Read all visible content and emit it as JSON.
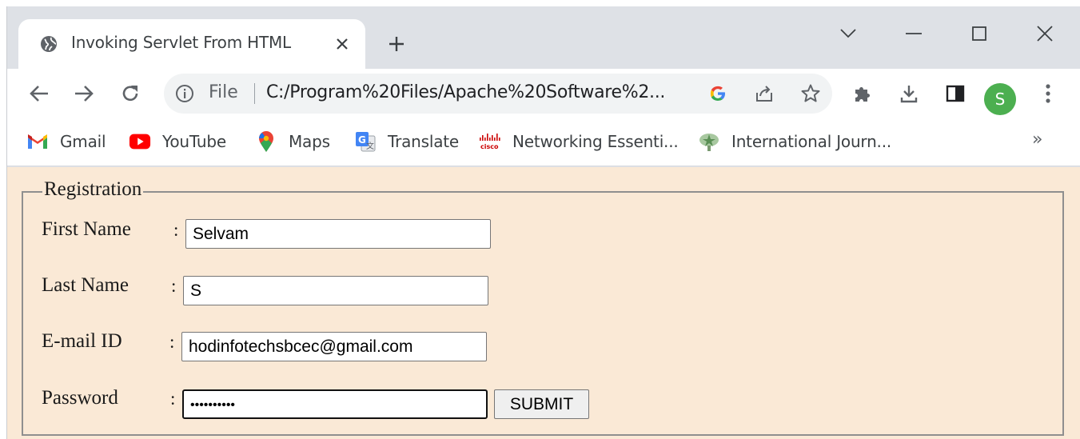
{
  "tab": {
    "title": "Invoking Servlet From HTML"
  },
  "omnibox": {
    "scheme_label": "File",
    "url": "C:/Program%20Files/Apache%20Software%2..."
  },
  "profile": {
    "initial": "S",
    "color": "#4caf50"
  },
  "bookmarks": [
    {
      "label": "Gmail",
      "icon": "gmail-icon"
    },
    {
      "label": "YouTube",
      "icon": "youtube-icon"
    },
    {
      "label": "Maps",
      "icon": "maps-icon"
    },
    {
      "label": "Translate",
      "icon": "translate-icon"
    },
    {
      "label": "Networking Essenti...",
      "icon": "cisco-icon"
    },
    {
      "label": "International Journ...",
      "icon": "journal-icon"
    }
  ],
  "bookmarks_overflow": "»",
  "form": {
    "legend": "Registration",
    "fields": [
      {
        "label": "First Name",
        "colon": ":",
        "value": "Selvam"
      },
      {
        "label": "Last Name",
        "colon": ":",
        "value": "S"
      },
      {
        "label": "E-mail ID",
        "colon": ":",
        "value": "hodinfotechsbcec@gmail.com"
      },
      {
        "label": "Password",
        "colon": ":",
        "value": "••••••••••"
      }
    ],
    "submit_label": "SUBMIT"
  },
  "colors": {
    "page_background": "#fae9d6",
    "tab_strip": "#dee1e6"
  }
}
